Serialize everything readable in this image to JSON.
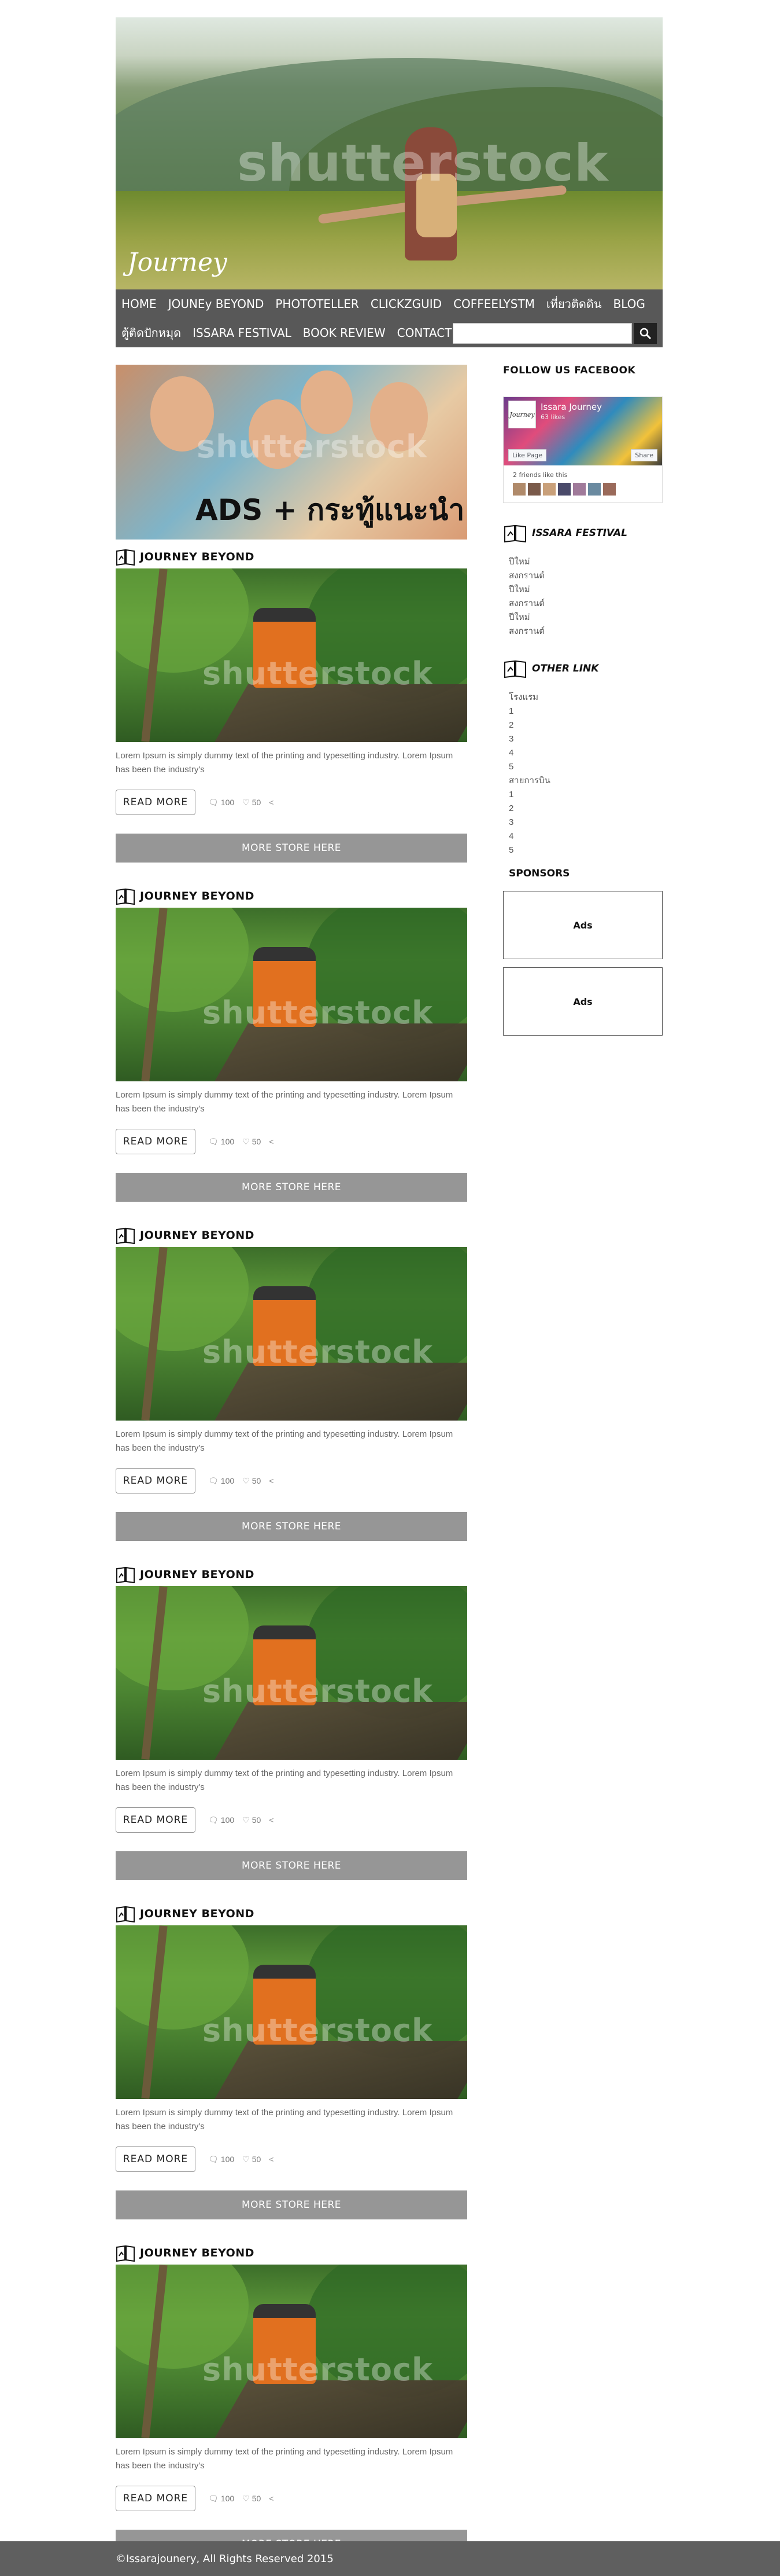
{
  "header": {
    "logo": "Journey",
    "watermark": "shutterstock",
    "nav_row1": [
      "HOME",
      "JOUNEy BEYOND",
      "PHOTOTELLER",
      "CLICKZGUID",
      "COFFEELYSTM",
      "เที่ยวติดดิน",
      "BLOG"
    ],
    "nav_row2": [
      "ตู้ติดปักหมุด",
      "ISSARA FESTIVAL",
      "BOOK REVIEW",
      "CONTACT US"
    ],
    "search_placeholder": ""
  },
  "ad_banner": {
    "text": "ADS + กระทู้แนะนำ",
    "watermark": "shutterstock"
  },
  "posts": [
    {
      "title": "JOURNEY BEYOND",
      "text": "Lorem Ipsum is simply dummy text of the printing and typesetting industry. Lorem Ipsum has been the industry's",
      "read_more": "READ MORE",
      "comments": "100",
      "likes": "50",
      "more": "MORE STORE HERE",
      "watermark": "shutterstock"
    },
    {
      "title": "JOURNEY BEYOND",
      "text": "Lorem Ipsum is simply dummy text of the printing and typesetting industry. Lorem Ipsum has been the industry's",
      "read_more": "READ MORE",
      "comments": "100",
      "likes": "50",
      "more": "MORE STORE HERE",
      "watermark": "shutterstock"
    },
    {
      "title": "JOURNEY BEYOND",
      "text": "Lorem Ipsum is simply dummy text of the printing and typesetting industry. Lorem Ipsum has been the industry's",
      "read_more": "READ MORE",
      "comments": "100",
      "likes": "50",
      "more": "MORE STORE HERE",
      "watermark": "shutterstock"
    },
    {
      "title": "JOURNEY BEYOND",
      "text": "Lorem Ipsum is simply dummy text of the printing and typesetting industry. Lorem Ipsum has been the industry's",
      "read_more": "READ MORE",
      "comments": "100",
      "likes": "50",
      "more": "MORE STORE HERE",
      "watermark": "shutterstock"
    },
    {
      "title": "JOURNEY BEYOND",
      "text": "Lorem Ipsum is simply dummy text of the printing and typesetting industry. Lorem Ipsum has been the industry's",
      "read_more": "READ MORE",
      "comments": "100",
      "likes": "50",
      "more": "MORE STORE HERE",
      "watermark": "shutterstock"
    },
    {
      "title": "JOURNEY BEYOND",
      "text": "Lorem Ipsum is simply dummy text of the printing and typesetting industry. Lorem Ipsum has been the industry's",
      "read_more": "READ MORE",
      "comments": "100",
      "likes": "50",
      "more": "MORE STORE HERE",
      "watermark": "shutterstock"
    }
  ],
  "sidebar": {
    "facebook_title": "FOLLOW US FACEBOOK",
    "fb": {
      "avatar": "Journey",
      "name": "Issara Journey",
      "likes": "63 likes",
      "like_btn": "Like Page",
      "share_btn": "Share",
      "friends": "2 friends like this"
    },
    "festival_title": "ISSARA FESTIVAL",
    "festival_items": [
      "ปีใหม่",
      "สงกรานต์",
      "ปีใหม่",
      "สงกรานต์",
      "ปีใหม่",
      "สงกรานต์"
    ],
    "other_title": "OTHER LINK",
    "other_items": [
      "โรงแรม",
      "1",
      "2",
      "3",
      "4",
      "5",
      "สายการบิน",
      "1",
      "2",
      "3",
      "4",
      "5"
    ],
    "sponsors_title": "SPONSORS",
    "ads": [
      "Ads",
      "Ads"
    ]
  },
  "footer": {
    "text": "©Issarajounery, All Rights Reserved 2015"
  }
}
